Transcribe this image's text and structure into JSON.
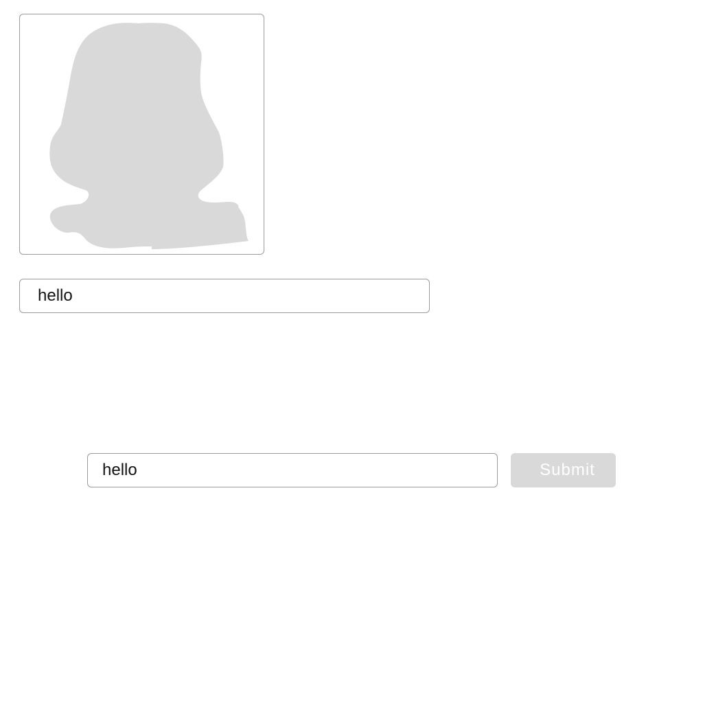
{
  "avatar": {
    "icon": "person-silhouette-icon",
    "fill_color": "#d9d9d9"
  },
  "top_field": {
    "value": "hello"
  },
  "form": {
    "input_value": "hello",
    "submit_label": "Submit",
    "submit_state": "disabled"
  },
  "colors": {
    "border": "#9a9a9a",
    "button_bg": "#d9d9d9",
    "button_text": "#ffffff"
  }
}
